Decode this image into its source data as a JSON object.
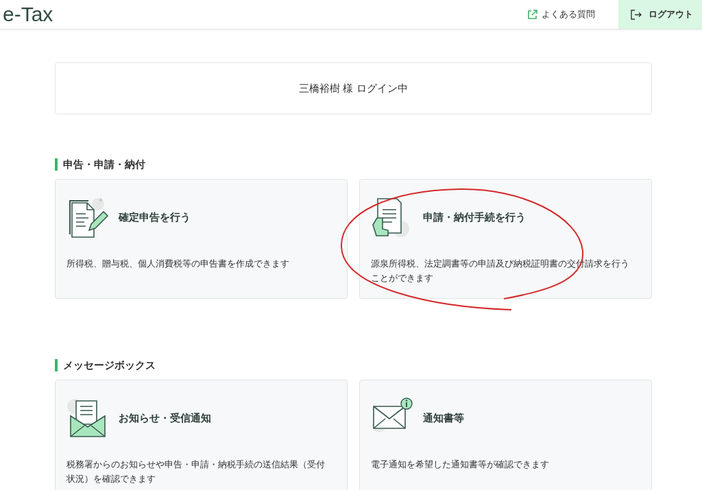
{
  "header": {
    "logo": "e-Tax",
    "faq_link": "よくある質問",
    "logout_button": "ログアウト"
  },
  "login_status": "三橋裕樹 様 ログイン中",
  "sections": [
    {
      "heading": "申告・申請・納付",
      "cards": [
        {
          "kind": "return",
          "title": "確定申告を行う",
          "description": "所得税、贈与税、個人消費税等の申告書を作成できます"
        },
        {
          "kind": "application",
          "title": "申請・納付手続を行う",
          "description": "源泉所得税、法定調書等の申請及び納税証明書の交付請求を行うことができます"
        }
      ]
    },
    {
      "heading": "メッセージボックス",
      "cards": [
        {
          "kind": "inbox",
          "title": "お知らせ・受信通知",
          "description": "税務署からのお知らせや申告・申請・納税手続の送信結果（受付状況）を確認できます"
        },
        {
          "kind": "notice",
          "title": "通知書等",
          "description": "電子通知を希望した通知書等が確認できます"
        }
      ]
    }
  ]
}
